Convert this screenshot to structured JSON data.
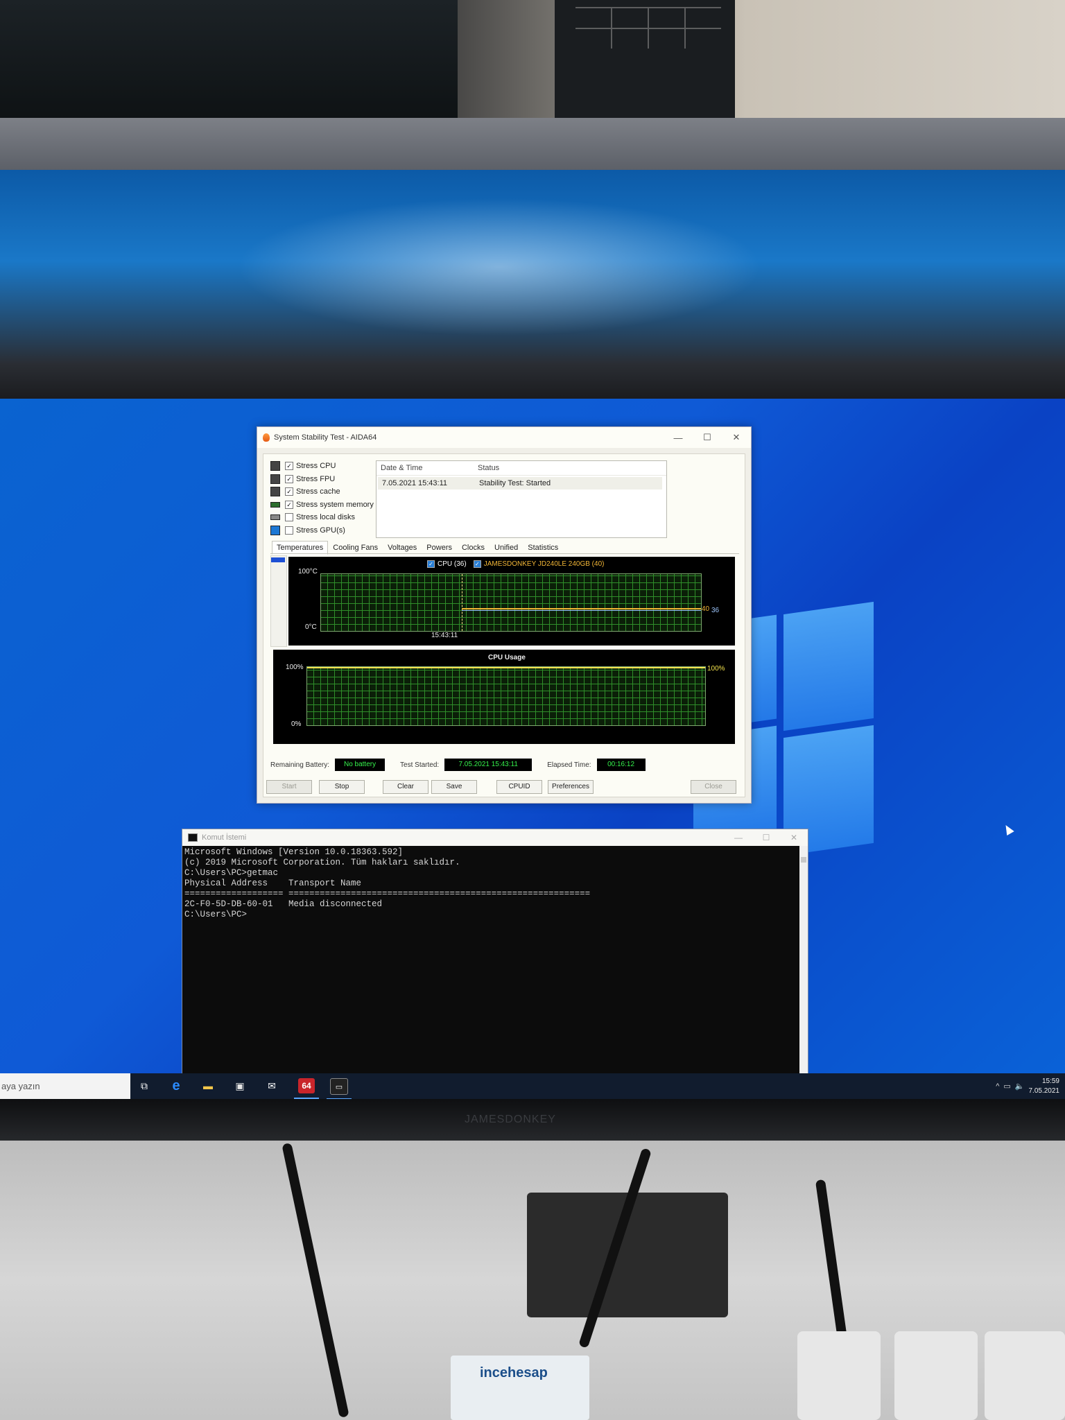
{
  "aida": {
    "title": "System Stability Test - AIDA64",
    "window_controls": {
      "minimize": "—",
      "maximize": "☐",
      "close": "✕"
    },
    "stress_options": [
      {
        "label": "Stress CPU",
        "checked": true
      },
      {
        "label": "Stress FPU",
        "checked": true
      },
      {
        "label": "Stress cache",
        "checked": true
      },
      {
        "label": "Stress system memory",
        "checked": true
      },
      {
        "label": "Stress local disks",
        "checked": false
      },
      {
        "label": "Stress GPU(s)",
        "checked": false
      }
    ],
    "log": {
      "headers": {
        "datetime": "Date & Time",
        "status": "Status"
      },
      "rows": [
        {
          "datetime": "7.05.2021 15:43:11",
          "status": "Stability Test: Started"
        }
      ]
    },
    "tabs": [
      "Temperatures",
      "Cooling Fans",
      "Voltages",
      "Powers",
      "Clocks",
      "Unified",
      "Statistics"
    ],
    "active_tab": "Temperatures",
    "temperature_graph": {
      "legend": [
        {
          "label": "CPU (36)",
          "checked": true,
          "color": "#ffffff"
        },
        {
          "label": "JAMESDONKEY JD240LE 240GB (40)",
          "checked": true,
          "color": "#f2b636"
        }
      ],
      "y_max_label": "100°C",
      "y_min_label": "0°C",
      "time_label": "15:43:11",
      "value_label_1": "40",
      "value_label_2": "36",
      "values": {
        "cpu": 36,
        "disk": 40
      }
    },
    "cpu_graph": {
      "title": "CPU Usage",
      "y_max_label": "100%",
      "y_min_label": "0%",
      "value_label": "100%",
      "value": 100
    },
    "status": {
      "battery_label": "Remaining Battery:",
      "battery_value": "No battery",
      "started_label": "Test Started:",
      "started_value": "7.05.2021 15:43:11",
      "elapsed_label": "Elapsed Time:",
      "elapsed_value": "00:16:12"
    },
    "buttons": {
      "start": "Start",
      "stop": "Stop",
      "clear": "Clear",
      "save": "Save",
      "cpuid": "CPUID",
      "preferences": "Preferences",
      "close": "Close"
    }
  },
  "cmd": {
    "title": "Komut İstemi",
    "lines": [
      "Microsoft Windows [Version 10.0.18363.592]",
      "(c) 2019 Microsoft Corporation. Tüm hakları saklıdır.",
      "",
      "C:\\Users\\PC>getmac",
      "",
      "Physical Address    Transport Name",
      "=================== ==========================================================",
      "2C-F0-5D-DB-60-01   Media disconnected",
      "",
      "C:\\Users\\PC>"
    ]
  },
  "taskbar": {
    "search_placeholder": "aya yazın",
    "apps": [
      {
        "name": "task-view",
        "glyph": "⧉"
      },
      {
        "name": "edge",
        "glyph": "e"
      },
      {
        "name": "file-explorer",
        "glyph": "▬"
      },
      {
        "name": "store",
        "glyph": "▣"
      },
      {
        "name": "mail",
        "glyph": "✉"
      },
      {
        "name": "aida64",
        "glyph": "64"
      },
      {
        "name": "command-prompt",
        "glyph": "▭"
      }
    ],
    "tray": {
      "chevron": "^",
      "network": "▭",
      "volume": "🔈"
    },
    "time": "15:59",
    "date": "7.05.2021"
  },
  "monitor_brand": "JAMESDONKEY",
  "desk_sticker": "incehesap"
}
